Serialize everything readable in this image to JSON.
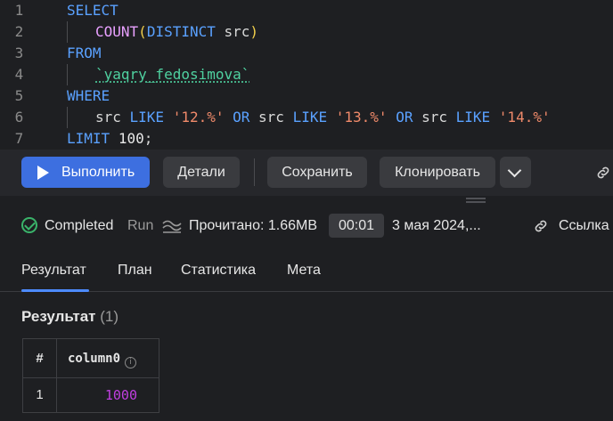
{
  "editor": {
    "lines": [
      {
        "n": "1",
        "parts": [
          {
            "c": "kw",
            "t": "SELECT"
          }
        ]
      },
      {
        "n": "2",
        "indent": true,
        "parts": [
          {
            "c": "fn",
            "t": "COUNT"
          },
          {
            "c": "paren",
            "t": "("
          },
          {
            "c": "kw",
            "t": "DISTINCT"
          },
          {
            "c": "tx",
            "t": " src"
          },
          {
            "c": "paren",
            "t": ")"
          }
        ]
      },
      {
        "n": "3",
        "parts": [
          {
            "c": "kw",
            "t": "FROM"
          }
        ]
      },
      {
        "n": "4",
        "indent": true,
        "parts": [
          {
            "c": "tbl",
            "t": "`yaqry_fedosimova`"
          }
        ]
      },
      {
        "n": "5",
        "parts": [
          {
            "c": "kw",
            "t": "WHERE"
          }
        ]
      },
      {
        "n": "6",
        "indent": true,
        "parts": [
          {
            "c": "tx",
            "t": "src "
          },
          {
            "c": "kw",
            "t": "LIKE"
          },
          {
            "c": "tx",
            "t": " "
          },
          {
            "c": "str",
            "t": "'12.%'"
          },
          {
            "c": "tx",
            "t": " "
          },
          {
            "c": "kw",
            "t": "OR"
          },
          {
            "c": "tx",
            "t": " src "
          },
          {
            "c": "kw",
            "t": "LIKE"
          },
          {
            "c": "tx",
            "t": " "
          },
          {
            "c": "str",
            "t": "'13.%'"
          },
          {
            "c": "tx",
            "t": " "
          },
          {
            "c": "kw",
            "t": "OR"
          },
          {
            "c": "tx",
            "t": " src "
          },
          {
            "c": "kw",
            "t": "LIKE"
          },
          {
            "c": "tx",
            "t": " "
          },
          {
            "c": "str",
            "t": "'14.%'"
          }
        ]
      },
      {
        "n": "7",
        "parts": [
          {
            "c": "kw",
            "t": "LIMIT"
          },
          {
            "c": "tx",
            "t": " "
          },
          {
            "c": "num",
            "t": "100"
          },
          {
            "c": "tx",
            "t": ";"
          }
        ]
      }
    ]
  },
  "toolbar": {
    "run_label": "Выполнить",
    "details_label": "Детали",
    "save_label": "Сохранить",
    "clone_label": "Клонировать"
  },
  "status": {
    "state": "Completed",
    "mode": "Run",
    "read": "Прочитано: 1.66MB",
    "duration": "00:01",
    "date": "3 мая 2024,...",
    "link_label": "Ссылка н"
  },
  "tabs": [
    "Результат",
    "План",
    "Статистика",
    "Мета"
  ],
  "result": {
    "title": "Результат",
    "count": "(1)",
    "columns": [
      "#",
      "column0"
    ],
    "rows": [
      {
        "index": "1",
        "value": "1000"
      }
    ]
  },
  "colors": {
    "accent": "#3d6fe0",
    "success": "#3ab36a",
    "number_value": "#c03fe0"
  }
}
